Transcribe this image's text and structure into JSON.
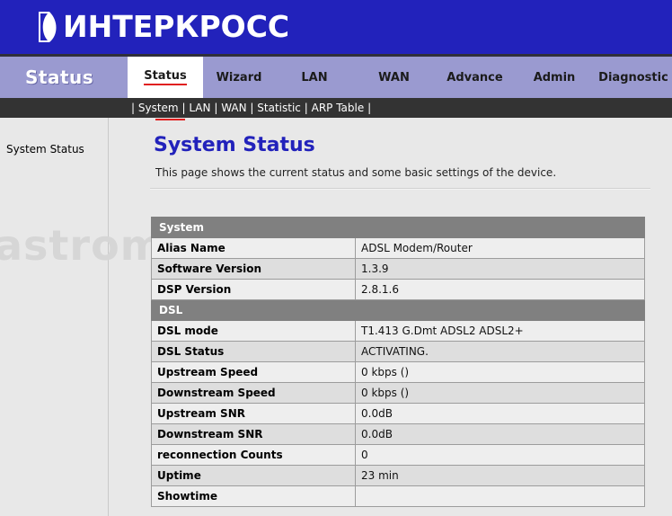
{
  "banner": {
    "logo_mark": "stylized-k-mark",
    "logo_text": "ИНТЕРКРОСС"
  },
  "nav": {
    "page_label": "Status",
    "tabs": [
      {
        "label": "Status",
        "active": true,
        "width": 84
      },
      {
        "label": "Wizard",
        "active": false,
        "width": 80
      },
      {
        "label": "LAN",
        "active": false,
        "width": 88
      },
      {
        "label": "WAN",
        "active": false,
        "width": 89
      },
      {
        "label": "Advance",
        "active": false,
        "width": 91
      },
      {
        "label": "Admin",
        "active": false,
        "width": 86
      },
      {
        "label": "Diagnostic",
        "active": false,
        "width": 90
      }
    ]
  },
  "subnav": {
    "prefix": "|",
    "items": [
      "System",
      "LAN",
      "WAN",
      "Statistic",
      "ARP Table"
    ],
    "separator": "|",
    "suffix": "|"
  },
  "sidebar": {
    "items": [
      {
        "label": "System Status"
      }
    ]
  },
  "content": {
    "title": "System Status",
    "description": "This page shows the current status and some basic settings of the device.",
    "watermark": "astrom.ru"
  },
  "status_table": {
    "rows": [
      {
        "type": "section",
        "label": "System"
      },
      {
        "type": "data",
        "key": "Alias Name",
        "value": "ADSL Modem/Router"
      },
      {
        "type": "data",
        "key": "Software Version",
        "value": "1.3.9"
      },
      {
        "type": "data",
        "key": "DSP Version",
        "value": "2.8.1.6"
      },
      {
        "type": "section",
        "label": "DSL"
      },
      {
        "type": "data",
        "key": "DSL mode",
        "value": "T1.413 G.Dmt ADSL2 ADSL2+"
      },
      {
        "type": "data",
        "key": "DSL Status",
        "value": "ACTIVATING."
      },
      {
        "type": "data",
        "key": "Upstream Speed",
        "value": "0 kbps  ()"
      },
      {
        "type": "data",
        "key": "Downstream Speed",
        "value": "0 kbps  ()"
      },
      {
        "type": "data",
        "key": "Upstream SNR",
        "value": "0.0dB"
      },
      {
        "type": "data",
        "key": "Downstream SNR",
        "value": "0.0dB"
      },
      {
        "type": "data",
        "key": "reconnection Counts",
        "value": "0"
      },
      {
        "type": "data",
        "key": "Uptime",
        "value": "23 min"
      },
      {
        "type": "data",
        "key": "Showtime",
        "value": ""
      }
    ]
  },
  "colors": {
    "banner_blue": "#2222bb",
    "nav_purple": "#9a9ad0",
    "subnav_dark": "#333333",
    "accent_red": "#e02020",
    "title_blue": "#2222bb",
    "section_gray": "#808080",
    "page_bg": "#e8e8e8"
  }
}
